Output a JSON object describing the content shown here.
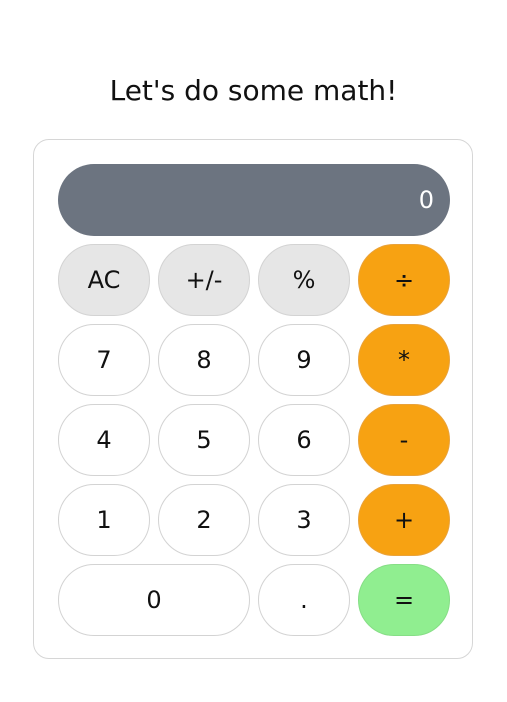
{
  "heading": "Let's do some math!",
  "display": {
    "value": "0"
  },
  "keys": {
    "ac": "AC",
    "plus_minus": "+/-",
    "percent": "%",
    "divide": "÷",
    "seven": "7",
    "eight": "8",
    "nine": "9",
    "multiply": "*",
    "four": "4",
    "five": "5",
    "six": "6",
    "subtract": "-",
    "one": "1",
    "two": "2",
    "three": "3",
    "add": "+",
    "zero": "0",
    "decimal": ".",
    "equals": "="
  },
  "colors": {
    "display_bg": "#6c7480",
    "function_key_bg": "#e6e6e6",
    "operator_key_bg": "#f7a212",
    "equals_key_bg": "#90ee90",
    "number_key_bg": "#ffffff"
  }
}
